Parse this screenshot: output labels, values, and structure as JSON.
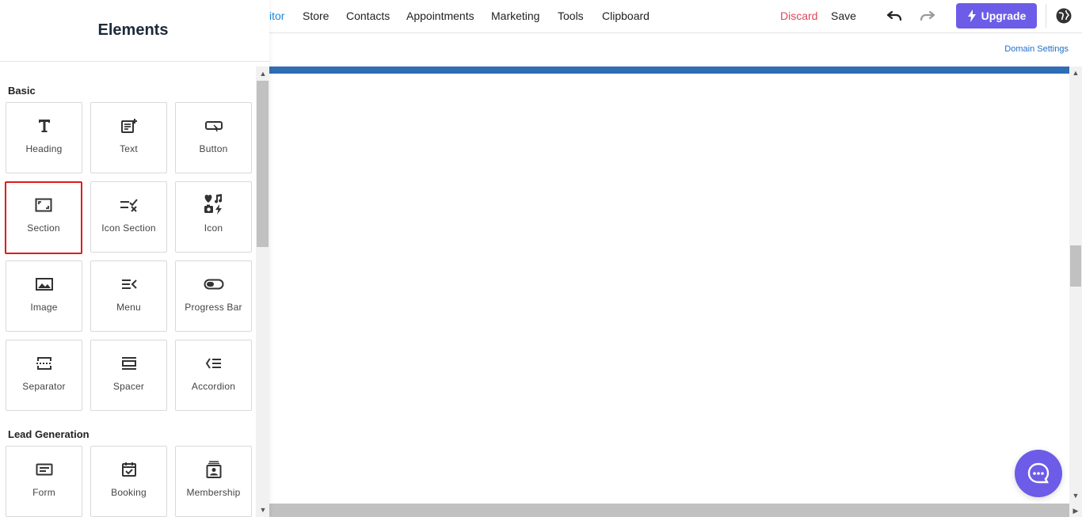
{
  "nav": {
    "items": [
      "itor",
      "Store",
      "Contacts",
      "Appointments",
      "Marketing",
      "Tools",
      "Clipboard"
    ],
    "discard": "Discard",
    "save": "Save",
    "upgrade": "Upgrade",
    "active_color": "#1e88d8",
    "upgrade_color": "#6c5ce7"
  },
  "subbar": {
    "domain_settings": "Domain Settings"
  },
  "sidebar": {
    "title": "Elements",
    "sections": [
      {
        "label": "Basic",
        "items": [
          {
            "label": "Heading",
            "icon": "heading-icon"
          },
          {
            "label": "Text",
            "icon": "text-icon"
          },
          {
            "label": "Button",
            "icon": "button-icon"
          },
          {
            "label": "Section",
            "icon": "section-icon",
            "selected": true
          },
          {
            "label": "Icon Section",
            "icon": "icon-section-icon"
          },
          {
            "label": "Icon",
            "icon": "icons-icon"
          },
          {
            "label": "Image",
            "icon": "image-icon"
          },
          {
            "label": "Menu",
            "icon": "menu-icon"
          },
          {
            "label": "Progress Bar",
            "icon": "progress-bar-icon"
          },
          {
            "label": "Separator",
            "icon": "separator-icon"
          },
          {
            "label": "Spacer",
            "icon": "spacer-icon"
          },
          {
            "label": "Accordion",
            "icon": "accordion-icon"
          }
        ]
      },
      {
        "label": "Lead Generation",
        "items": [
          {
            "label": "Form",
            "icon": "form-icon"
          },
          {
            "label": "Booking",
            "icon": "booking-icon"
          },
          {
            "label": "Membership",
            "icon": "membership-icon"
          }
        ]
      }
    ]
  },
  "canvas": {
    "top_bar_color": "#2f6db4"
  }
}
